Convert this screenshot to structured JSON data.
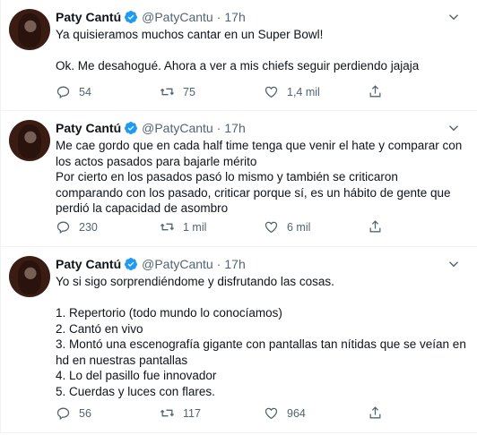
{
  "tweets": [
    {
      "name": "Paty Cantú",
      "handle": "@PatyCantu",
      "time": "17h",
      "text": "Ya quisieramos muchos cantar en un Super Bowl!\n\nOk. Me desahogué. Ahora a ver a mis chiefs seguir perdiendo jajaja",
      "replies": "54",
      "retweets": "75",
      "likes": "1,4 mil"
    },
    {
      "name": "Paty Cantú",
      "handle": "@PatyCantu",
      "time": "17h",
      "text": "Me cae gordo que en cada half time tenga que venir el hate y comparar con los actos pasados para bajarle mérito\nPor cierto en los pasados pasó lo mismo y también se criticaron comparando con los pasado, criticar porque sí, es un hábito de gente que perdió la capacidad de asombro",
      "replies": "230",
      "retweets": "1 mil",
      "likes": "6 mil"
    },
    {
      "name": "Paty Cantú",
      "handle": "@PatyCantu",
      "time": "17h",
      "text": "Yo si sigo sorprendiéndome y disfrutando las cosas.\n\n1. Repertorio (todo mundo lo conocíamos)\n2. Cantó en vivo\n3. Montó una escenografía gigante con pantallas tan nítidas que se veían en hd en nuestras pantallas\n4. Lo del pasillo fue innovador\n5. Cuerdas y luces con flares.",
      "replies": "56",
      "retweets": "117",
      "likes": "964"
    }
  ],
  "colors": {
    "verified": "#1d9bf0",
    "secondary": "#536471",
    "border": "#eff3f4"
  },
  "icons": [
    "verified-badge-icon",
    "more-options-icon",
    "reply-icon",
    "retweet-icon",
    "like-icon",
    "share-icon"
  ]
}
